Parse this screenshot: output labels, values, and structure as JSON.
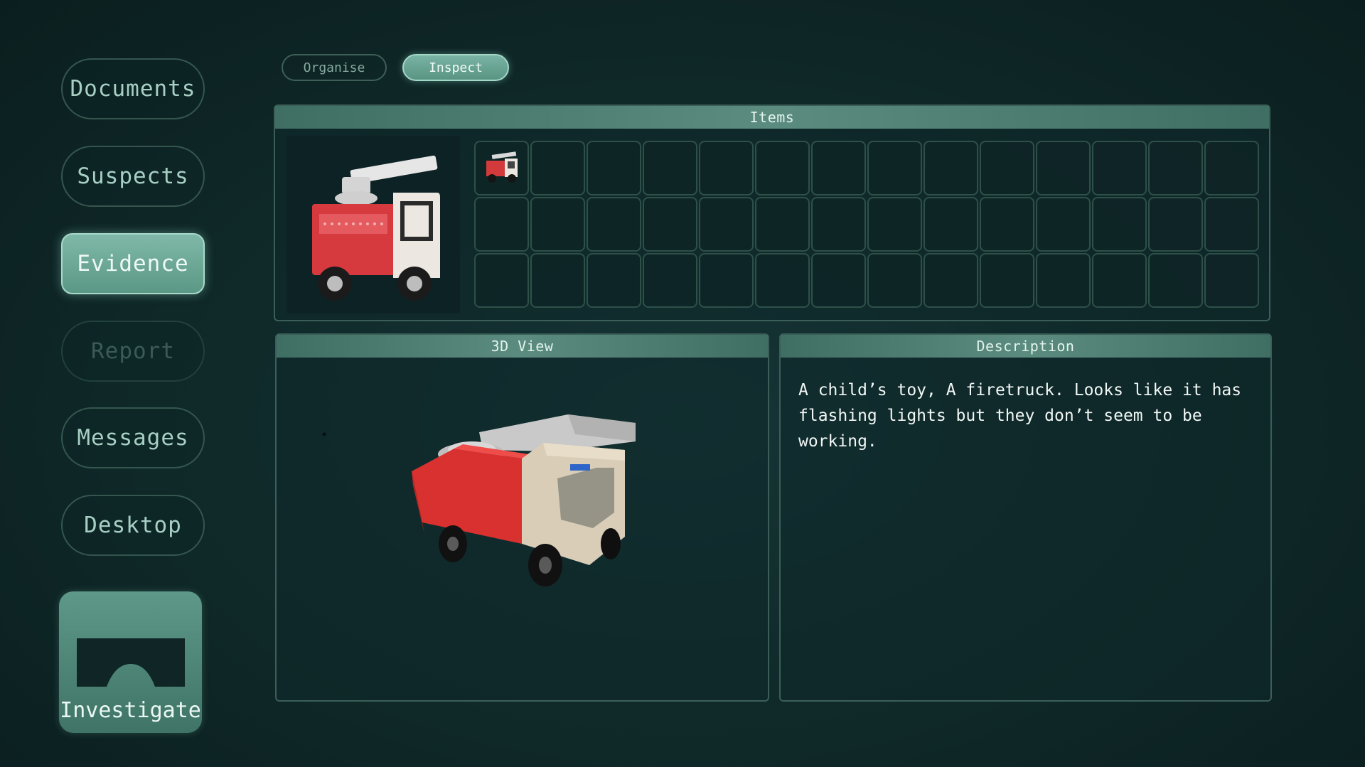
{
  "nav": {
    "documents": "Documents",
    "suspects": "Suspects",
    "evidence": "Evidence",
    "report": "Report",
    "messages": "Messages",
    "desktop": "Desktop",
    "investigate": "Investigate",
    "active": "Evidence",
    "disabled": "Report"
  },
  "tabs": {
    "organise": "Organise",
    "inspect": "Inspect",
    "active": "Inspect"
  },
  "items": {
    "title": "Items",
    "slots_total": 42,
    "filled_slots": [
      {
        "index": 0,
        "item": "firetruck-toy-icon"
      }
    ]
  },
  "view3d": {
    "title": "3D View"
  },
  "description": {
    "title": "Description",
    "text": "A child’s toy, A firetruck. Looks like it has flashing lights but they don’t seem to be working."
  },
  "colors": {
    "accent": "#6fa898",
    "background": "#0f2828",
    "border": "#3b5f58"
  }
}
